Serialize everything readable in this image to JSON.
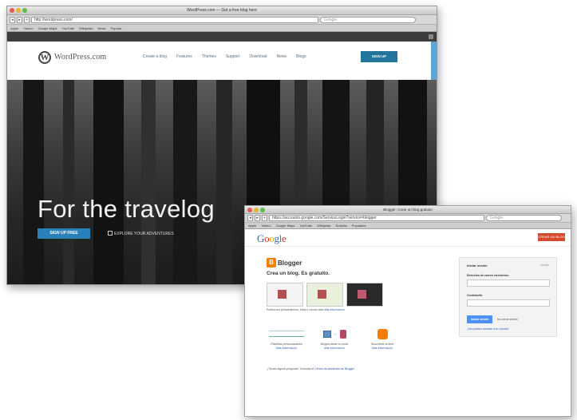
{
  "wordpress_window": {
    "title": "WordPress.com — Get a free blog here",
    "url": "http://wordpress.com/",
    "search_placeholder": "Google",
    "bookmarks": [
      "Apple",
      "Yahoo!",
      "Google Maps",
      "YouTube",
      "Wikipedia",
      "News",
      "Popular"
    ],
    "logo_text": "WordPress.com",
    "nav": [
      "Create a blog",
      "Features",
      "Themes",
      "Support",
      "Download",
      "News",
      "Blogs"
    ],
    "signup_top": "SIGN UP",
    "hero_title": "For the travelog",
    "hero_signup": "SIGN UP FREE",
    "hero_explore": "EXPLORE YOUR ADVENTURES"
  },
  "blogger_window": {
    "title": "Blogger: Crear un blog gratuito",
    "url": "https://accounts.google.com/ServiceLogin?service=blogger",
    "search_placeholder": "Google",
    "bookmarks": [
      "Apple",
      "Yahoo!",
      "Google Maps",
      "YouTube",
      "Wikipedia",
      "Noticias",
      "Populares"
    ],
    "header_button": "CREAR UN BLOG",
    "brand": "Blogger",
    "heading": "Crea un blog. Es gratuito.",
    "thumb_caption": "Publica tus pensamientos, fotos y mucho más",
    "thumb_caption_link": "Más información",
    "features": [
      {
        "label": "Plantillas personalizables",
        "link": "Más información"
      },
      {
        "label": "Blogea desde tu móvil",
        "link": "Más información"
      },
      {
        "label": "Suscríbete al feed",
        "link": "Más información"
      }
    ],
    "bottom_text": "¿Tienes alguna pregunta? Consulta el",
    "bottom_link": "Centro de asistencia de Blogger",
    "signin": {
      "title": "Iniciar sesión",
      "google": "Google",
      "email_label": "Dirección de correo electrónico",
      "password_label": "Contraseña",
      "button": "Iniciar sesión",
      "keep": "No cerrar sesión",
      "forgot": "¿No puedes acceder a tu cuenta?"
    }
  },
  "colors": {
    "wp_blue": "#21759b",
    "hero_button": "#2a80b9",
    "blogger_orange": "#f57d00",
    "google_red": "#d6492d",
    "signin_blue": "#4d90fe"
  }
}
